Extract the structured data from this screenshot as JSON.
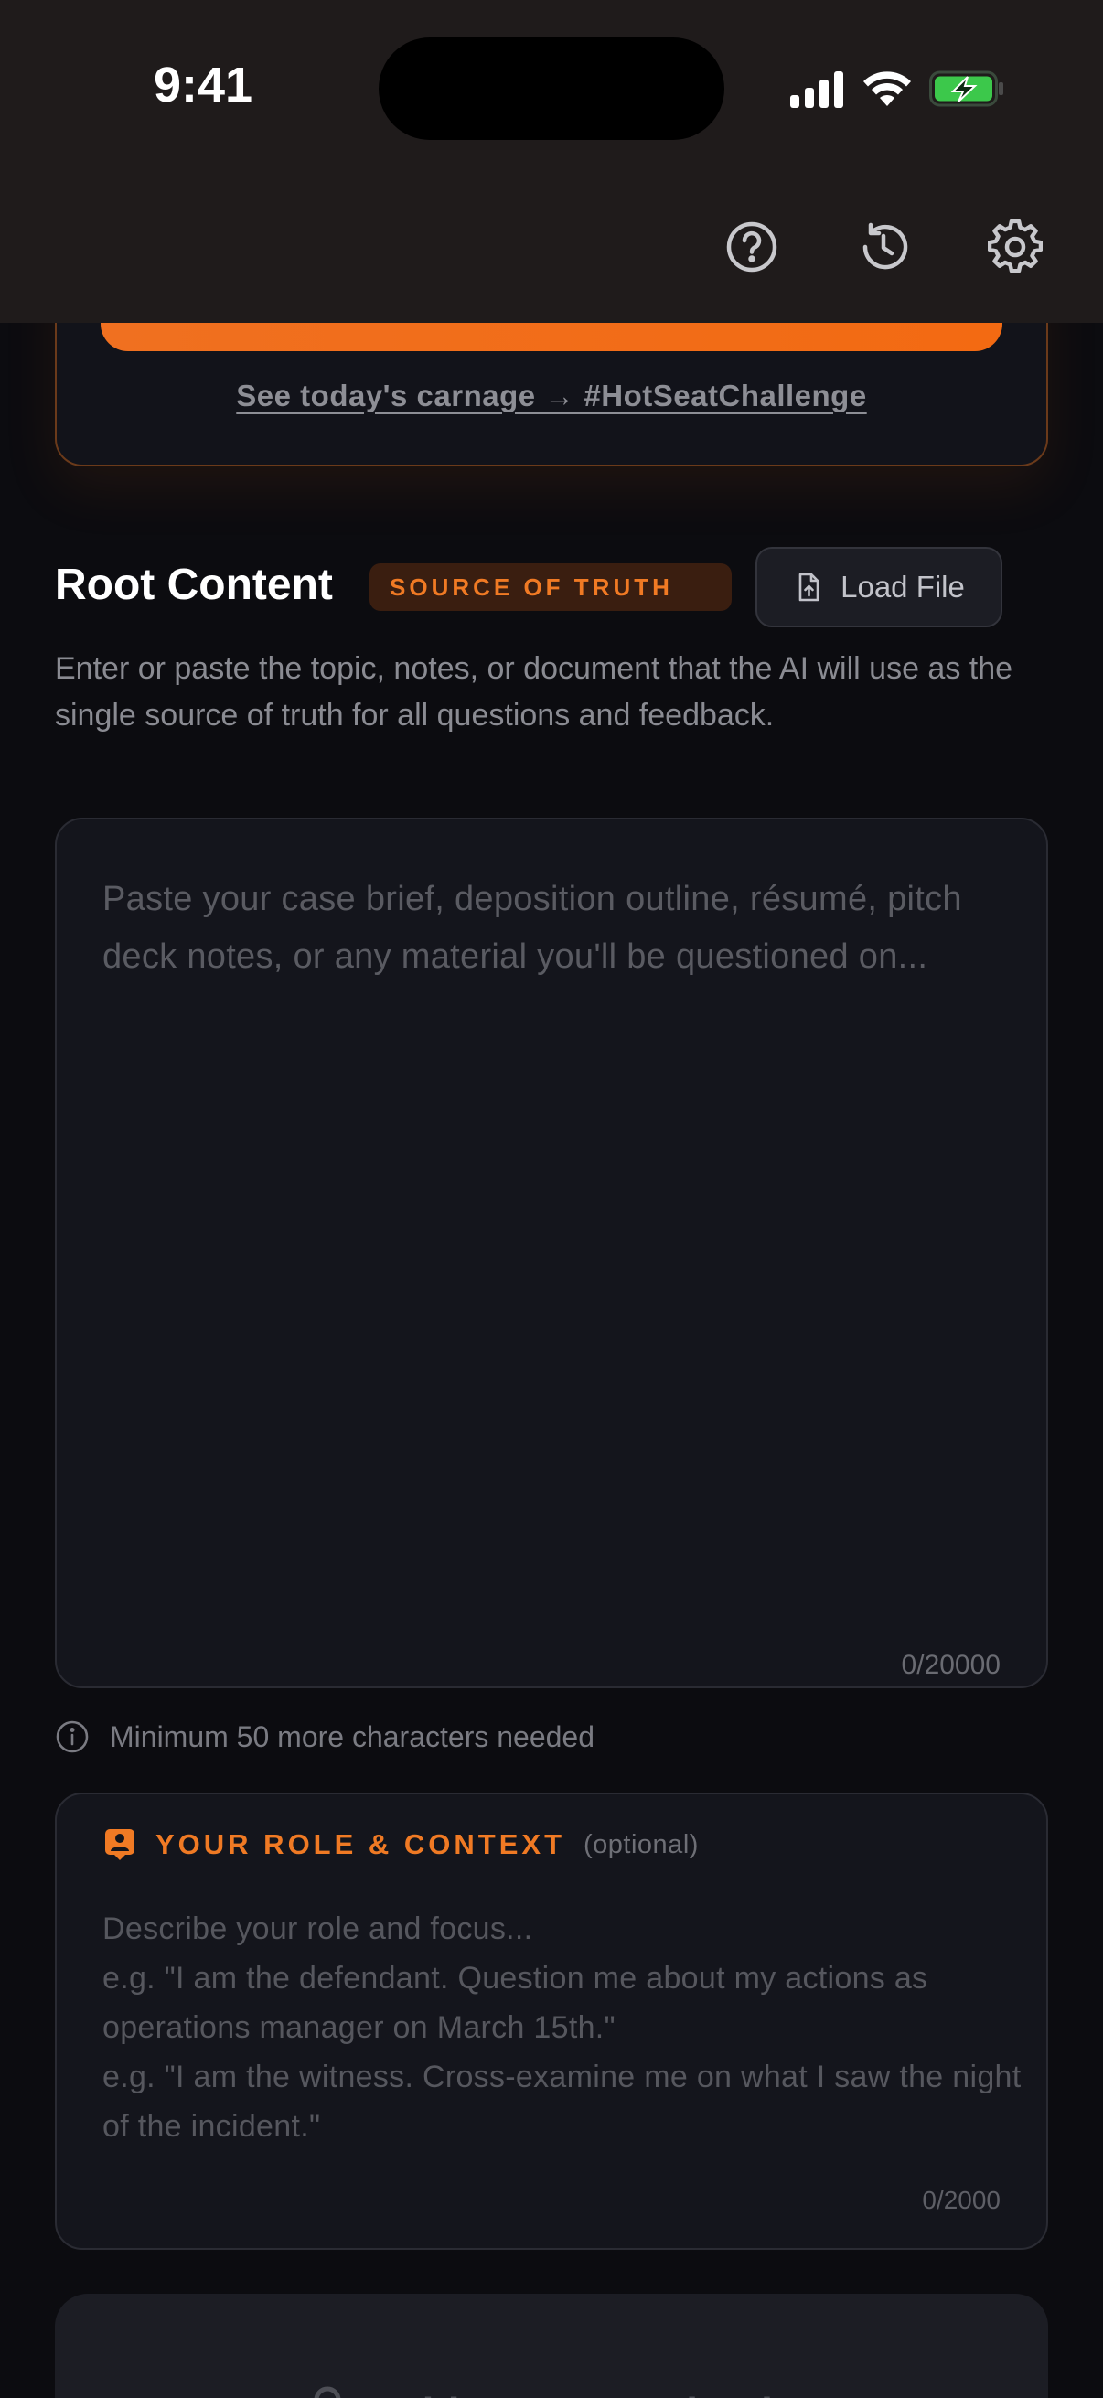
{
  "status_bar": {
    "time": "9:41"
  },
  "nav": {
    "icons": [
      "help-circle-icon",
      "history-icon",
      "settings-gear-icon"
    ]
  },
  "hero": {
    "link_text": "See today's carnage → #HotSeatChallenge"
  },
  "root_content": {
    "title": "Root Content",
    "badge": "SOURCE OF TRUTH",
    "load_button_label": "Load File",
    "description": "Enter or paste the topic, notes, or document that the AI will use as the single source of truth for all questions and feedback.",
    "placeholder": "Paste your case brief, deposition outline, résumé, pitch deck notes, or any material you'll be questioned on...",
    "value": "",
    "char_count": "0/20000"
  },
  "hint": {
    "text": "Minimum 50 more characters needed"
  },
  "role": {
    "title": "YOUR ROLE & CONTEXT",
    "optional_label": "(optional)",
    "placeholder": "Describe your role and focus...\ne.g. \"I am the defendant. Question me about my actions as operations manager on March 15th.\"\ne.g. \"I am the witness. Cross-examine me on what I saw the night of the incident.\"",
    "value": "",
    "char_count": "0/2000"
  },
  "begin_button": {
    "label": "Add content to begin",
    "icon": "lock-icon"
  },
  "colors": {
    "accent": "#f07a24",
    "background": "#0c0c10",
    "card": "#14151c",
    "topbar": "#1f1b1b",
    "battery": "#3cc84b"
  }
}
